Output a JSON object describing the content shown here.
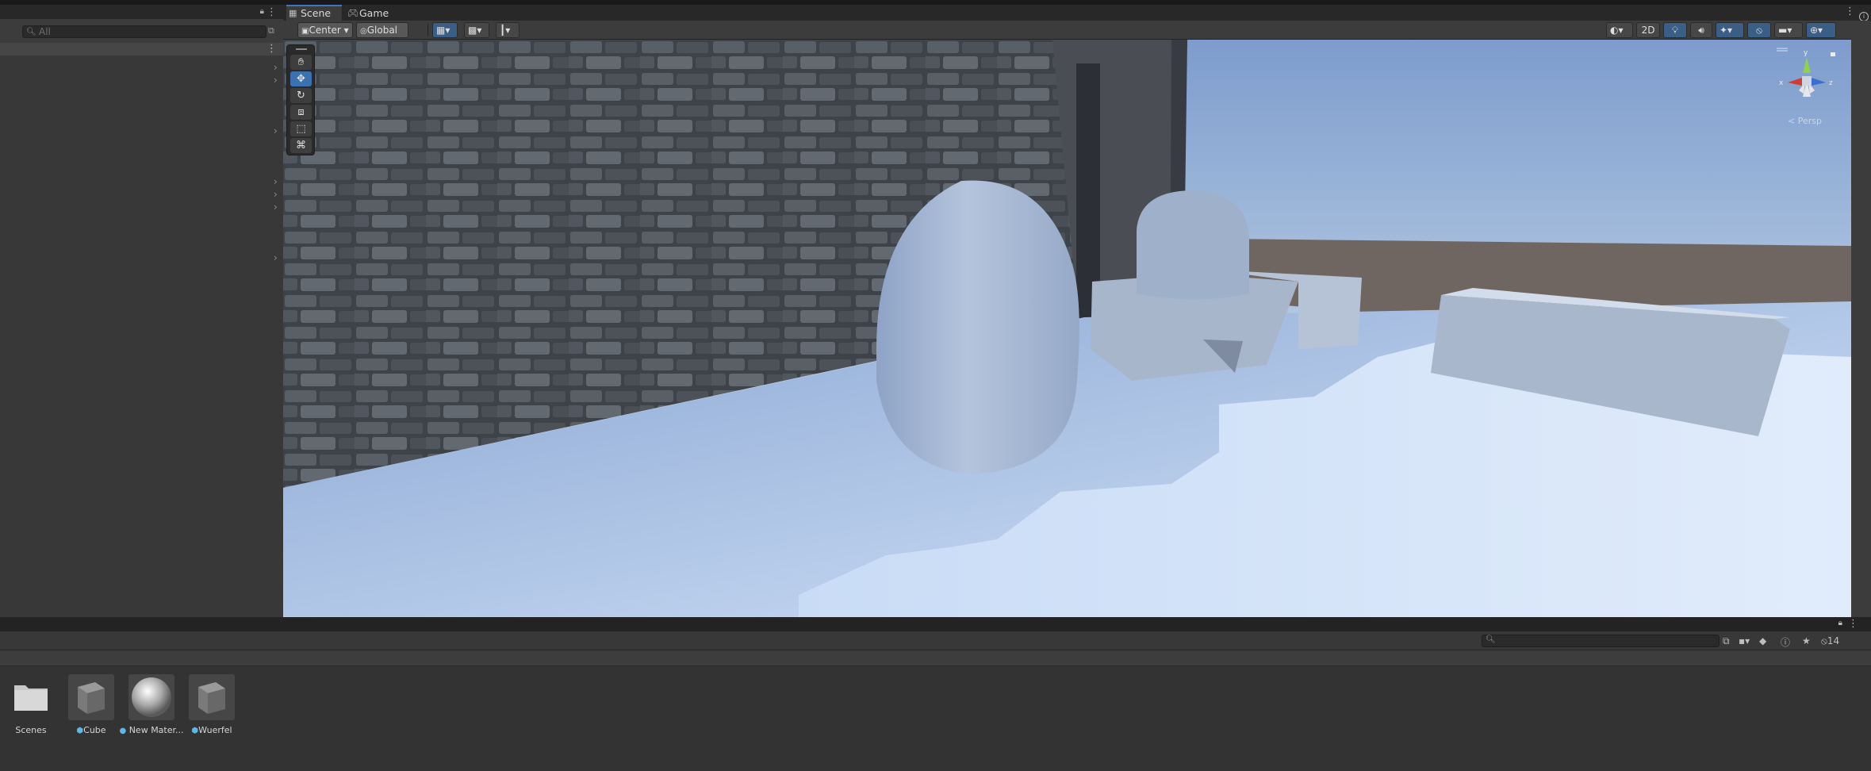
{
  "hierarchy": {
    "search_placeholder": "All",
    "lock_icon": "lock-icon",
    "more_icon": "kebab-menu-icon"
  },
  "scene_view": {
    "tabs": [
      {
        "label": "Scene",
        "icon": "grid-icon",
        "active": true
      },
      {
        "label": "Game",
        "icon": "gamepad-icon",
        "active": false
      }
    ],
    "toolbar": {
      "pivot_mode": "Center",
      "pivot_rotation": "Global",
      "mode_2d": "2D"
    },
    "tools": [
      "View Tool",
      "Move Tool",
      "Rotate Tool",
      "Scale Tool",
      "Rect Tool",
      "Transform Tool"
    ],
    "active_tool": "Move Tool",
    "gizmo": {
      "axes": [
        "x",
        "y",
        "z"
      ],
      "projection_label": "< Persp"
    },
    "accent_color": "#3a79bb"
  },
  "project": {
    "hidden_count": "14",
    "assets": [
      {
        "name": "Scenes",
        "type": "folder"
      },
      {
        "name": "Cube",
        "type": "prefab"
      },
      {
        "name": "New Mater...",
        "type": "material"
      },
      {
        "name": "Wuerfel",
        "type": "prefab"
      }
    ]
  }
}
